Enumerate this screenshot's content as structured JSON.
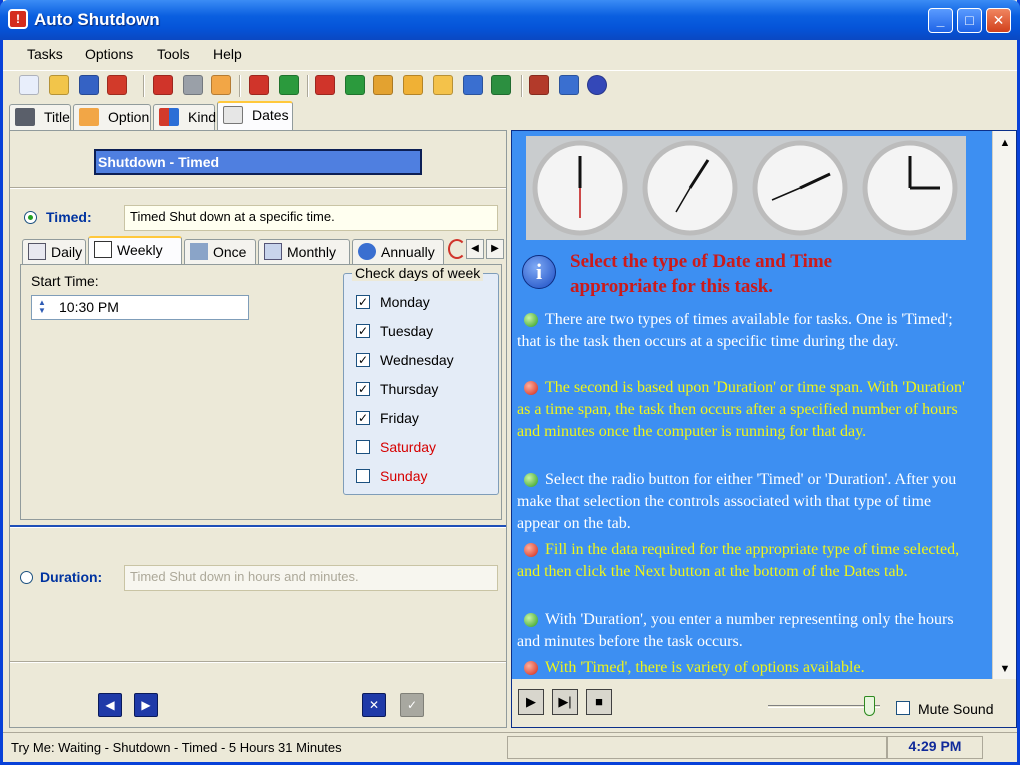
{
  "window": {
    "title": "Auto Shutdown"
  },
  "menu": {
    "tasks": "Tasks",
    "options": "Options",
    "tools": "Tools",
    "help": "Help"
  },
  "main_tabs": [
    {
      "label": "Title"
    },
    {
      "label": "Option"
    },
    {
      "label": "Kind"
    },
    {
      "label": "Dates"
    }
  ],
  "left": {
    "heading": "Shutdown - Timed",
    "timed_label": "Timed:",
    "timed_desc": "Timed Shut down at a specific time.",
    "sub_tabs": [
      {
        "label": "Daily"
      },
      {
        "label": "Weekly"
      },
      {
        "label": "Once"
      },
      {
        "label": "Monthly"
      },
      {
        "label": "Annually"
      }
    ],
    "start_time_label": "Start Time:",
    "start_time_value": "10:30 PM",
    "days_group_label": "Check days of week",
    "days": [
      {
        "name": "Monday",
        "checked": "✓"
      },
      {
        "name": "Tuesday",
        "checked": "✓"
      },
      {
        "name": "Wednesday",
        "checked": "✓"
      },
      {
        "name": "Thursday",
        "checked": "✓"
      },
      {
        "name": "Friday",
        "checked": "✓"
      },
      {
        "name": "Saturday",
        "checked": ""
      },
      {
        "name": "Sunday",
        "checked": ""
      }
    ],
    "duration_label": "Duration:",
    "duration_placeholder": "Timed Shut down in hours and minutes."
  },
  "info": {
    "heading": "Select the type of Date and Time appropriate for this task.",
    "paragraphs": [
      "There are two types of times available for tasks. One is 'Timed'; that is the task then occurs at a specific time during the day.",
      "The second is based upon 'Duration' or time span. With 'Duration' as a time span, the task then occurs after a specified number of hours and minutes once the computer is running for that day.",
      "Select the radio button for either 'Timed' or 'Duration'. After you make that selection the controls associated with that type of time appear on the tab.",
      "Fill in the data required for the appropriate type of time selected, and then click the Next button at the bottom of the Dates tab.",
      "With 'Duration', you enter a number representing only the hours and minutes before the task occurs.",
      "With 'Timed', there is variety of options available."
    ],
    "mute_label": "Mute Sound",
    "volume_level": 0.85
  },
  "status": {
    "text": "Try Me:  Waiting - Shutdown - Timed - 5 Hours 31 Minutes",
    "time": "4:29 PM"
  },
  "colors": {
    "accent": "#0a5fe0",
    "info_bg": "#3d8ff2",
    "heading_red": "#cc1a1a",
    "para_yellow": "#eff51a"
  }
}
